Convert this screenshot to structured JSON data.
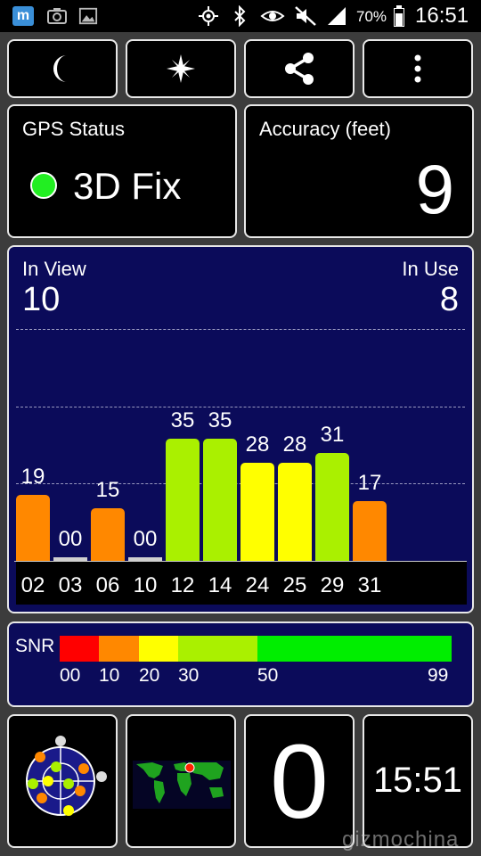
{
  "status_bar": {
    "battery": "70%",
    "time": "16:51",
    "left_icons": [
      "m-app-icon",
      "camera-icon",
      "image-icon"
    ],
    "right_icons": [
      "gps-icon",
      "bluetooth-icon",
      "eye-icon",
      "mute-icon",
      "signal-icon",
      "battery-icon"
    ]
  },
  "toolbar": {
    "buttons": [
      "night-mode-button",
      "compass-button",
      "share-button",
      "menu-button"
    ]
  },
  "gps_status": {
    "title": "GPS Status",
    "status": "3D Fix",
    "indicator_color": "#22ee22"
  },
  "accuracy": {
    "title": "Accuracy (feet)",
    "value": "9"
  },
  "satellites": {
    "in_view_label": "In View",
    "in_view_value": "10",
    "in_use_label": "In Use",
    "in_use_value": "8",
    "bars": [
      {
        "prn": "02",
        "snr": 19,
        "label": "19",
        "color": "#ff8800"
      },
      {
        "prn": "03",
        "snr": 0,
        "label": "00",
        "color": "#d0d0d0"
      },
      {
        "prn": "06",
        "snr": 15,
        "label": "15",
        "color": "#ff8800"
      },
      {
        "prn": "10",
        "snr": 0,
        "label": "00",
        "color": "#d0d0d0"
      },
      {
        "prn": "12",
        "snr": 35,
        "label": "35",
        "color": "#aaf000"
      },
      {
        "prn": "14",
        "snr": 35,
        "label": "35",
        "color": "#aaf000"
      },
      {
        "prn": "24",
        "snr": 28,
        "label": "28",
        "color": "#ffff00"
      },
      {
        "prn": "25",
        "snr": 28,
        "label": "28",
        "color": "#ffff00"
      },
      {
        "prn": "29",
        "snr": 31,
        "label": "31",
        "color": "#aaf000"
      },
      {
        "prn": "31",
        "snr": 17,
        "label": "17",
        "color": "#ff8800"
      }
    ]
  },
  "snr_legend": {
    "title": "SNR",
    "segments": [
      {
        "from": 0,
        "to": 10,
        "color": "#ff0000"
      },
      {
        "from": 10,
        "to": 20,
        "color": "#ff8800"
      },
      {
        "from": 20,
        "to": 30,
        "color": "#ffff00"
      },
      {
        "from": 30,
        "to": 50,
        "color": "#aaf000"
      },
      {
        "from": 50,
        "to": 99,
        "color": "#00ee00"
      }
    ],
    "ticks": [
      "00",
      "10",
      "20",
      "30",
      "50",
      "99"
    ]
  },
  "bottom": {
    "speed_value": "0",
    "clock_value": "15:51",
    "watermark": "gizmochina"
  }
}
